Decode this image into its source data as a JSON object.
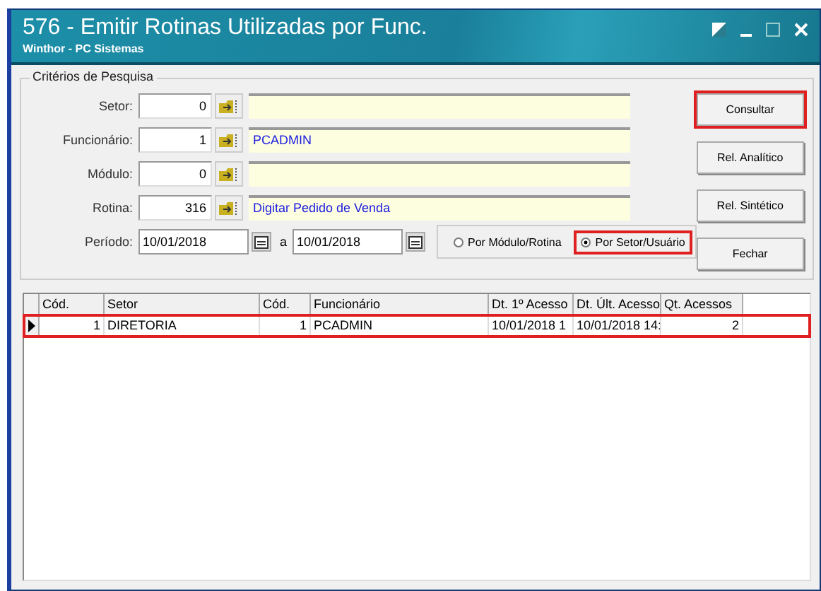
{
  "window": {
    "title": "576 - Emitir Rotinas Utilizadas por Func.",
    "subtitle": "Winthor - PC Sistemas"
  },
  "criteria": {
    "legend": "Critérios de Pesquisa",
    "fields": [
      {
        "label": "Setor:",
        "code": "0"
      },
      {
        "label": "Funcionário:",
        "code": "1",
        "description": "PCADMIN"
      },
      {
        "label": "Módulo:",
        "code": "0"
      },
      {
        "label": "Rotina:",
        "code": "316",
        "description": "Digitar Pedido de Venda"
      }
    ],
    "period": {
      "label": "Período:",
      "from": "10/01/2018",
      "separator": "a",
      "to": "10/01/2018"
    },
    "options": [
      {
        "label": "Por Módulo/Rotina",
        "selected": false,
        "highlighted": false
      },
      {
        "label": "Por Setor/Usuário",
        "selected": true,
        "highlighted": true
      }
    ]
  },
  "buttons": [
    {
      "label": "Consultar",
      "highlighted": true
    },
    {
      "label": "Rel. Analítico",
      "highlighted": false
    },
    {
      "label": "Rel. Sintético",
      "highlighted": false
    },
    {
      "label": "Fechar",
      "highlighted": false
    }
  ],
  "table": {
    "columns": [
      "Cód.",
      "Setor",
      "Cód.",
      "Funcionário",
      "Dt. 1º Acesso",
      "Dt. Últ. Acesso",
      "Qt. Acessos"
    ],
    "rows": [
      {
        "cells": [
          "1",
          "DIRETORIA",
          "1",
          "PCADMIN",
          "10/01/2018 1",
          "10/01/2018 14:",
          "2"
        ],
        "selected": true,
        "highlighted": true
      }
    ]
  }
}
